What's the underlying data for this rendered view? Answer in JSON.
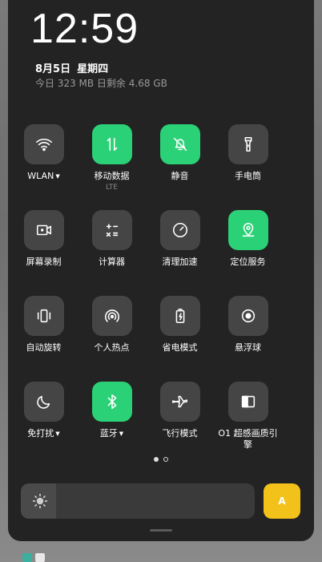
{
  "status": {
    "time": "12:59",
    "date": "8月5日",
    "weekday": "星期四",
    "data_usage": "今日 323 MB 日剩余 4.68 GB"
  },
  "tiles": [
    {
      "label": "WLAN",
      "active": false,
      "caret": true,
      "icon": "wifi-icon"
    },
    {
      "label": "移动数据",
      "active": true,
      "sub": "LTE",
      "icon": "mobile-data-icon"
    },
    {
      "label": "静音",
      "active": true,
      "icon": "mute-bell-icon"
    },
    {
      "label": "手电筒",
      "active": false,
      "icon": "flashlight-icon"
    },
    {
      "label": "屏幕录制",
      "active": false,
      "icon": "screen-record-icon"
    },
    {
      "label": "计算器",
      "active": false,
      "icon": "calculator-icon"
    },
    {
      "label": "清理加速",
      "active": false,
      "icon": "speed-gauge-icon"
    },
    {
      "label": "定位服务",
      "active": true,
      "icon": "location-icon"
    },
    {
      "label": "自动旋转",
      "active": false,
      "icon": "auto-rotate-icon"
    },
    {
      "label": "个人热点",
      "active": false,
      "icon": "hotspot-icon"
    },
    {
      "label": "省电模式",
      "active": false,
      "icon": "battery-saver-icon"
    },
    {
      "label": "悬浮球",
      "active": false,
      "icon": "floating-ball-icon"
    },
    {
      "label": "免打扰",
      "active": false,
      "caret": true,
      "icon": "moon-icon"
    },
    {
      "label": "蓝牙",
      "active": true,
      "caret": true,
      "icon": "bluetooth-icon"
    },
    {
      "label": "飞行模式",
      "active": false,
      "icon": "airplane-icon"
    },
    {
      "label": "O1 超感画质引擎",
      "active": false,
      "icon": "display-quality-icon"
    }
  ],
  "pager": {
    "current": 1,
    "total": 2
  },
  "brightness": {
    "level": 0.15,
    "icon": "sun-icon",
    "auto_label": "A"
  },
  "colors": {
    "active": "#2bd176",
    "tile": "#454545",
    "panel": "#232323",
    "auto": "#f2c21a"
  }
}
